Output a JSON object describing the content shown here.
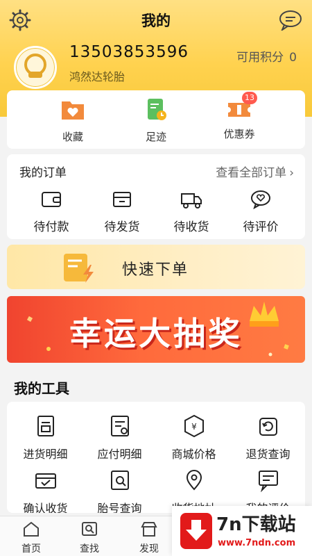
{
  "header": {
    "title": "我的",
    "phone": "13503853596",
    "points_label": "可用积分",
    "points_value": "0",
    "shop_name": "鸿然达轮胎"
  },
  "quick": [
    {
      "label": "收藏",
      "icon": "favorites-folder-icon"
    },
    {
      "label": "足迹",
      "icon": "footprint-icon"
    },
    {
      "label": "优惠券",
      "icon": "coupon-icon",
      "badge": "13"
    }
  ],
  "orders": {
    "title": "我的订单",
    "view_all": "查看全部订单",
    "chevron": "›",
    "items": [
      {
        "label": "待付款",
        "icon": "wallet-icon"
      },
      {
        "label": "待发货",
        "icon": "package-icon"
      },
      {
        "label": "待收货",
        "icon": "truck-icon"
      },
      {
        "label": "待评价",
        "icon": "review-bubble-icon"
      }
    ]
  },
  "fast_order": {
    "label": "快速下单"
  },
  "lottery": {
    "text": "幸运大抽奖"
  },
  "tools": {
    "title": "我的工具",
    "items": [
      {
        "label": "进货明细",
        "icon": "purchase-detail-icon"
      },
      {
        "label": "应付明细",
        "icon": "payable-detail-icon"
      },
      {
        "label": "商城价格",
        "icon": "price-icon"
      },
      {
        "label": "退货查询",
        "icon": "return-icon"
      },
      {
        "label": "确认收货",
        "icon": "confirm-receipt-icon"
      },
      {
        "label": "胎号查询",
        "icon": "tire-number-search-icon"
      },
      {
        "label": "收货地址",
        "icon": "location-pin-icon"
      },
      {
        "label": "我的评价",
        "icon": "my-review-icon"
      }
    ]
  },
  "bottom_nav": [
    {
      "label": "首页",
      "icon": "home-icon"
    },
    {
      "label": "查找",
      "icon": "search-icon"
    },
    {
      "label": "发现",
      "icon": "store-icon"
    }
  ],
  "watermark": {
    "name": "7n下载站",
    "url": "www.7ndn.com"
  },
  "colors": {
    "accent": "#ffd24f",
    "orange": "#f0883e",
    "badge": "#ff5a4e",
    "lottery": "#f0442f"
  }
}
